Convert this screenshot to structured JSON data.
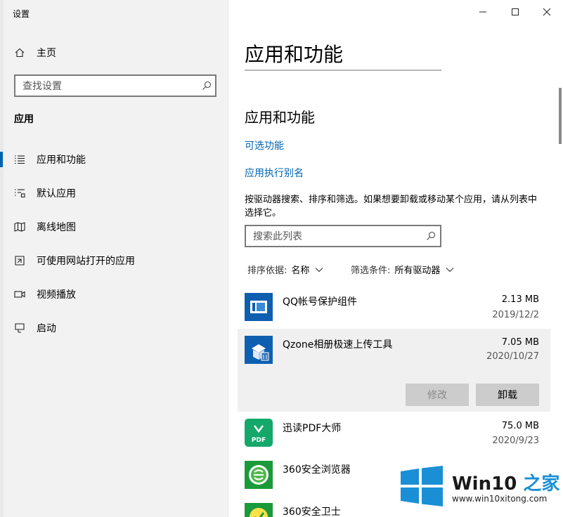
{
  "window": {
    "title": "设置"
  },
  "sidebar": {
    "home_label": "主页",
    "search_placeholder": "查找设置",
    "section_heading": "应用",
    "items": [
      {
        "label": "应用和功能",
        "icon": "list-icon",
        "active": true
      },
      {
        "label": "默认应用",
        "icon": "default-apps-icon",
        "active": false
      },
      {
        "label": "离线地图",
        "icon": "map-icon",
        "active": false
      },
      {
        "label": "可使用网站打开的应用",
        "icon": "open-website-icon",
        "active": false
      },
      {
        "label": "视频播放",
        "icon": "video-icon",
        "active": false
      },
      {
        "label": "启动",
        "icon": "startup-icon",
        "active": false
      }
    ]
  },
  "main": {
    "page_title": "应用和功能",
    "section_title": "应用和功能",
    "links": {
      "optional_features": "可选功能",
      "app_aliases": "应用执行别名"
    },
    "description": "按驱动器搜索、排序和筛选。如果想要卸载或移动某个应用，请从列表中选择它。",
    "search_placeholder": "搜索此列表",
    "sort": {
      "label": "排序依据:",
      "value": "名称"
    },
    "filter": {
      "label": "筛选条件:",
      "value": "所有驱动器"
    },
    "apps": [
      {
        "name": "QQ帐号保护组件",
        "size": "2.13 MB",
        "date": "2019/12/2",
        "icon": "qq-protect-icon"
      },
      {
        "name": "Qzone相册极速上传工具",
        "size": "7.05 MB",
        "date": "2020/10/27",
        "icon": "qzone-upload-icon",
        "selected": true,
        "buttons": {
          "modify": "修改",
          "uninstall": "卸载"
        }
      },
      {
        "name": "迅读PDF大师",
        "size": "75.0 MB",
        "date": "2020/9/23",
        "icon": "pdf-icon"
      },
      {
        "name": "360安全浏览器",
        "icon": "360-browser-icon"
      },
      {
        "name": "360安全卫士",
        "icon": "360-security-icon"
      }
    ]
  },
  "watermark": {
    "brand_a": "Win10",
    "brand_b": " 之家",
    "url": "www.win10xitong.com"
  },
  "colors": {
    "accent": "#0063b1",
    "sidebar_bg": "#f2f2f2",
    "selected_row": "#f0f0f0",
    "watermark_blue": "#1a8fd6"
  }
}
